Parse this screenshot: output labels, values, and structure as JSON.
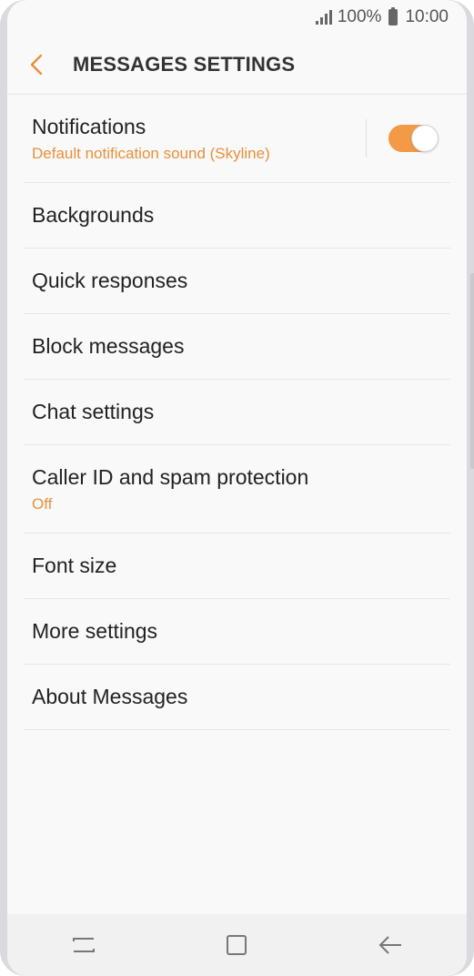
{
  "status_bar": {
    "battery": "100%",
    "time": "10:00"
  },
  "header": {
    "title": "MESSAGES SETTINGS"
  },
  "settings": [
    {
      "label": "Notifications",
      "sub": "Default notification sound (Skyline)",
      "toggle": true
    },
    {
      "label": "Backgrounds"
    },
    {
      "label": "Quick responses"
    },
    {
      "label": "Block messages"
    },
    {
      "label": "Chat settings"
    },
    {
      "label": "Caller ID and spam protection",
      "sub": "Off"
    },
    {
      "label": "Font size"
    },
    {
      "label": "More settings"
    },
    {
      "label": "About Messages"
    }
  ],
  "colors": {
    "accent": "#e8903a",
    "toggle_on": "#f29a45"
  },
  "icons": {
    "back": "chevron-left-icon",
    "recent": "recent-apps-icon",
    "home": "home-icon",
    "nav_back": "arrow-left-icon"
  }
}
